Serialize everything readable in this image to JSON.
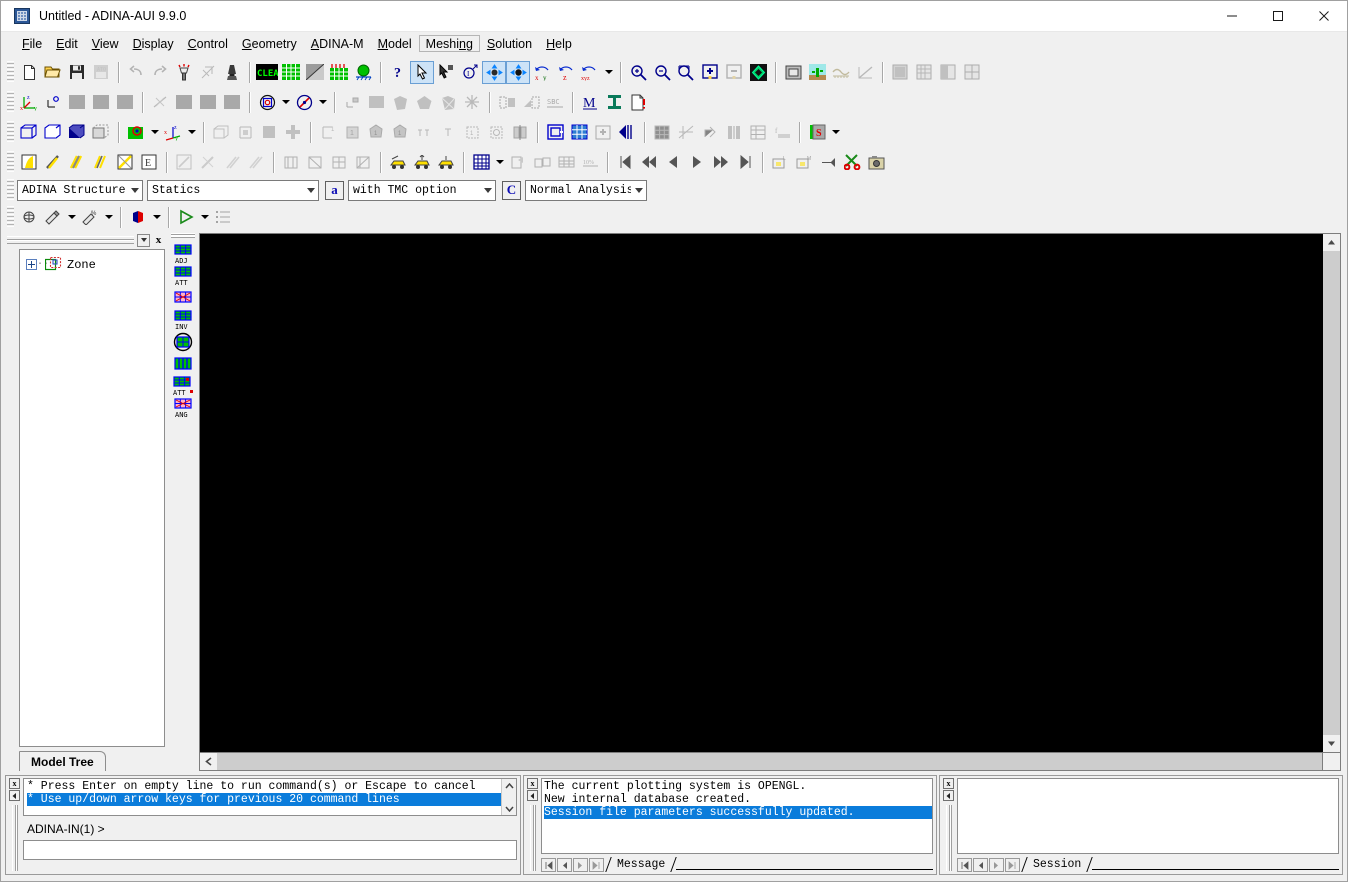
{
  "window": {
    "title": "Untitled - ADINA-AUI  9.9.0",
    "app_icon": "adina-app-icon",
    "minimize": "—",
    "maximize": "□",
    "close": "✕"
  },
  "menubar": {
    "items": [
      {
        "label": "File",
        "accel": "F"
      },
      {
        "label": "Edit",
        "accel": "E"
      },
      {
        "label": "View",
        "accel": "V"
      },
      {
        "label": "Display",
        "accel": "D"
      },
      {
        "label": "Control",
        "accel": "C"
      },
      {
        "label": "Geometry",
        "accel": "G"
      },
      {
        "label": "ADINA-M",
        "accel": "A"
      },
      {
        "label": "Model",
        "accel": "M"
      },
      {
        "label": "Meshing",
        "accel": "n",
        "hover": true
      },
      {
        "label": "Solution",
        "accel": "S"
      },
      {
        "label": "Help",
        "accel": "H"
      }
    ]
  },
  "toolbar_rows": [
    {
      "name": "standard-toolbar",
      "groups": [
        [
          "new-file-icon",
          "open-folder-icon",
          "save-disk-icon",
          "auto-save-icon"
        ],
        [
          "undo-arrow-icon",
          "redo-arrow-icon",
          "regenerate-icon",
          "clear-mesh-icon",
          "lamp-icon"
        ],
        [
          "clear-text-icon",
          "mesh-green-icon",
          "mesh-shade-icon",
          "mesh-load-icon",
          "support-green-icon"
        ],
        [
          "help-question-icon",
          "pick-arrow-icon",
          "pick-node-icon",
          "query-icon",
          "move-xyz-icon"
        ],
        [
          "pan-xyz-icon",
          "rotate-xy-icon",
          "rotate-z-icon",
          "rotate-xyz-icon",
          "rotate-dropdown-caret"
        ],
        [
          "zoom-in-icon",
          "zoom-out-icon",
          "zoom-window-icon",
          "scale-up-icon",
          "scale-down-icon",
          "mesh-colors-icon"
        ],
        [
          "frame-icon",
          "cactus-icon",
          "ruler-icon",
          "axis-line-icon"
        ],
        [
          "shade-full-icon",
          "shade-grid-icon",
          "shade-half-icon",
          "shade-quad-icon"
        ]
      ]
    },
    {
      "name": "geometry-toolbar",
      "groups": [
        [
          "coord-system-icon",
          "point-icon",
          "blank1-icon",
          "blank2-icon",
          "blank3-icon"
        ],
        [
          "line-delete-icon",
          "blank4-icon",
          "blank5-icon",
          "blank6-icon"
        ],
        [
          "sphere-target-icon",
          "sphere-dropdown-caret",
          "compass-icon",
          "compass-dropdown-caret"
        ],
        [
          "point-small-icon",
          "surface-icon",
          "face-icon",
          "volume-icon",
          "surface-mesh-icon",
          "star-icon"
        ],
        [
          "bc-apply-icon",
          "bc-load-icon",
          "sbc-icon"
        ],
        [
          "material-m-icon",
          "section-i-icon",
          "doc-alert-icon"
        ]
      ]
    },
    {
      "name": "view-toolbar",
      "groups": [
        [
          "wireframe-cube-icon",
          "outline-cube-icon",
          "solid-cube-icon",
          "hidden-cube-icon"
        ],
        [
          "green-plane-icon",
          "green-plane-dropdown-caret",
          "axes-z-icon",
          "axes-dropdown-caret"
        ],
        [
          "box-outline-icon",
          "bound-icon",
          "fill-square-icon",
          "cross-icon"
        ],
        [
          "node1-icon",
          "elem1-icon",
          "group1-icon",
          "group2-icon",
          "merge1-icon",
          "merge2-icon",
          "frame1-icon",
          "frame2-icon",
          "split-icon"
        ],
        [
          "group-g-icon",
          "mesh-plot-icon",
          "mesh-move-icon",
          "flip-icon"
        ],
        [
          "grid-icon",
          "skew-icon",
          "node-move-icon",
          "band-icon",
          "table-icon",
          "format-icon"
        ],
        [
          "save-s-icon",
          "save-s-dropdown-caret"
        ]
      ]
    },
    {
      "name": "results-toolbar",
      "groups": [
        [
          "band-plot-icon",
          "vector-plot-icon",
          "mesh-band-icon",
          "contour-icon",
          "cut-icon",
          "elem-e-icon"
        ],
        [
          "clear-band-icon",
          "clear-vector-icon",
          "clear-mesh2-icon",
          "clear-mesh3-icon"
        ],
        [
          "group-a-icon",
          "group-b-icon",
          "group-c-icon",
          "group-d-icon"
        ],
        [
          "load-car-icon",
          "load-car2-icon",
          "load-car3-icon"
        ],
        [
          "table-blue-icon",
          "table-dropdown-caret",
          "export-icon",
          "sheet-icon",
          "grid-table-icon",
          "percent-icon"
        ],
        [
          "first-frame-icon",
          "prev-fast-icon",
          "prev-frame-icon",
          "next-frame-icon",
          "next-fast-icon",
          "last-frame-icon"
        ],
        [
          "snap-l-icon",
          "snap-m-icon",
          "pin-icon",
          "scissors-icon",
          "camera-icon"
        ]
      ]
    }
  ],
  "combobar": {
    "program": {
      "value": "ADINA Structure",
      "name": "program-select"
    },
    "analysis": {
      "value": "Statics",
      "name": "analysis-type-select"
    },
    "tmc_button": {
      "label": "a",
      "name": "tmc-button"
    },
    "tmc": {
      "value": "with TMC option",
      "name": "tmc-option-select"
    },
    "control_button": {
      "label": "C",
      "name": "control-button"
    },
    "mode": {
      "value": "Normal Analysis",
      "name": "analysis-mode-select"
    }
  },
  "solution_toolbar": {
    "items": [
      "data-file-run-icon",
      "run-adina-icon",
      "run-adina-dropdown-caret",
      "run-post-icon",
      "run-post-dropdown-caret",
      "open-porthole-icon",
      "open-porthole-dropdown-caret",
      "run-play-icon",
      "run-play-dropdown-caret",
      "list-icon"
    ]
  },
  "left_panel": {
    "tree": {
      "root_label": "Zone",
      "root_icon": "zone-icon",
      "expander": "plus-expander"
    },
    "tab": {
      "label": "Model Tree",
      "name": "tab-model-tree"
    },
    "dropdown_button": "panel-dropdown-button",
    "close_button": "panel-close-button"
  },
  "vertical_toolbar": {
    "buttons": [
      {
        "icon": "mesh-adj-icon",
        "caption": "ADJ"
      },
      {
        "icon": "mesh-att-icon",
        "caption": "ATT"
      },
      {
        "icon": "mesh-pink-icon",
        "caption": ""
      },
      {
        "icon": "mesh-inv-icon",
        "caption": "INV"
      },
      {
        "icon": "mesh-circle-icon",
        "caption": ""
      },
      {
        "icon": "mesh-cols-icon",
        "caption": ""
      },
      {
        "icon": "mesh-attdot-icon",
        "caption": "ATT•"
      },
      {
        "icon": "mesh-ang-icon",
        "caption": "ANG"
      }
    ]
  },
  "viewport": {
    "name": "graphics-canvas",
    "background": "#000000",
    "vscroll": {
      "up": "scroll-up-arrow",
      "down": "scroll-down-arrow"
    },
    "hscroll": {
      "left": "scroll-left-arrow"
    }
  },
  "command_pane": {
    "name": "command-window",
    "history": [
      {
        "text": "* Press Enter on empty line to run command(s) or Escape to cancel",
        "selected": false
      },
      {
        "text": "* Use up/down arrow keys for previous 20 command lines",
        "selected": true
      }
    ],
    "prompt": "ADINA-IN(1) >",
    "input_value": "",
    "close_button": "command-close-button",
    "collapse_button": "command-collapse-button",
    "scroll_up": "history-scroll-up",
    "scroll_down": "history-scroll-down"
  },
  "message_pane": {
    "name": "message-window",
    "lines": [
      {
        "text": "The current plotting system is OPENGL.",
        "selected": false
      },
      {
        "text": " New internal database created.",
        "selected": false
      },
      {
        "text": "Session file parameters successfully updated.",
        "selected": true
      }
    ],
    "tab_label": "Message",
    "nav": [
      "nav-first-icon",
      "nav-prev-icon",
      "nav-next-icon",
      "nav-last-icon"
    ],
    "close_button": "message-close-button",
    "collapse_button": "message-collapse-button"
  },
  "session_pane": {
    "name": "session-window",
    "lines": [],
    "tab_label": "Session",
    "nav": [
      "nav-first-icon",
      "nav-prev-icon",
      "nav-next-icon",
      "nav-last-icon"
    ],
    "close_button": "session-close-button",
    "collapse_button": "session-collapse-button"
  },
  "colors": {
    "selection_blue": "#0a7cdb",
    "toolbar_bg": "#f0f0f0",
    "canvas_black": "#000000",
    "accent_blue": "#0b0bb5",
    "mesh_green": "#00c000"
  }
}
